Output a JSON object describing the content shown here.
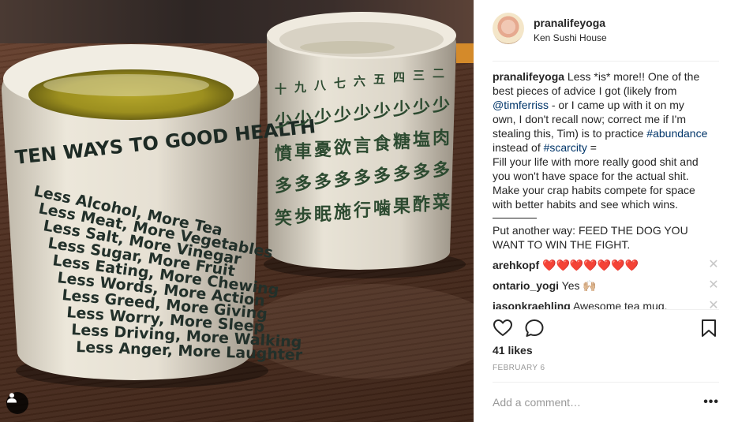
{
  "photo": {
    "left_cup_heading": "TEN WAYS TO GOOD HEALTH",
    "left_cup_lines": [
      "Less Alcohol, More Tea",
      "Less Meat, More Vegetables",
      "Less Salt, More Vinegar",
      "Less Sugar, More Fruit",
      "Less Eating, More Chewing",
      "Less Words, More Action",
      "Less Greed, More Giving",
      "Less Worry, More Sleep",
      "Less Driving, More Walking",
      "Less Anger, More Laughter"
    ],
    "right_cup_numerals": [
      "十",
      "九",
      "八",
      "七",
      "六",
      "五",
      "四",
      "三",
      "二"
    ],
    "right_cup_row2": [
      "少",
      "少",
      "少",
      "少",
      "少",
      "少",
      "少",
      "少",
      "少"
    ],
    "right_cup_row3": [
      "憤",
      "車",
      "憂",
      "欲",
      "言",
      "食",
      "糖",
      "塩",
      "肉"
    ],
    "right_cup_row4": [
      "多",
      "多",
      "多",
      "多",
      "多",
      "多",
      "多",
      "多",
      "多"
    ],
    "right_cup_row5": [
      "笑",
      "歩",
      "眠",
      "施",
      "行",
      "噛",
      "果",
      "酢",
      "菜"
    ],
    "tag_icon": "user-tag-icon"
  },
  "post": {
    "username": "pranalifeyoga",
    "location": "Ken Sushi House",
    "caption": {
      "username": "pranalifeyoga",
      "l1": "Less *is* more!! One of the",
      "l2": "best pieces of advice I got (likely from",
      "mention": "@timferriss",
      "l3": " - or I came up with it on my",
      "l4": "own, I don't recall now; correct me if I'm",
      "l5": "stealing this, Tim) is to practice",
      "hashtag1": "#abundance",
      "l6": "instead of",
      "hashtag2": "#scarcity",
      "l6b": " =",
      "l7": "Fill your life with more really good shit and",
      "l8": "you won't have space for the actual shit.",
      "l9": "Make your crap habits compete for space",
      "l10": "with better habits and see which wins.",
      "l11": "Put another way: FEED THE DOG YOU",
      "l12": "WANT TO WIN THE FIGHT."
    },
    "comments": [
      {
        "user": "arehkopf",
        "text": "❤️❤️❤️❤️❤️❤️❤️"
      },
      {
        "user": "ontario_yogi",
        "text": "Yes 🙌🏼"
      },
      {
        "user": "jasonkraehling",
        "text": "Awesome tea mug."
      }
    ],
    "remove_glyph": "✕",
    "likes": "41 likes",
    "date": "FEBRUARY 6",
    "comment_placeholder": "Add a comment…",
    "more_glyph": "•••"
  },
  "icons": [
    "heart-icon",
    "comment-icon",
    "bookmark-icon",
    "close-icon",
    "more-icon"
  ],
  "colors": {
    "link": "#003569",
    "muted": "#999999",
    "border": "#efefef",
    "text": "#262626"
  }
}
